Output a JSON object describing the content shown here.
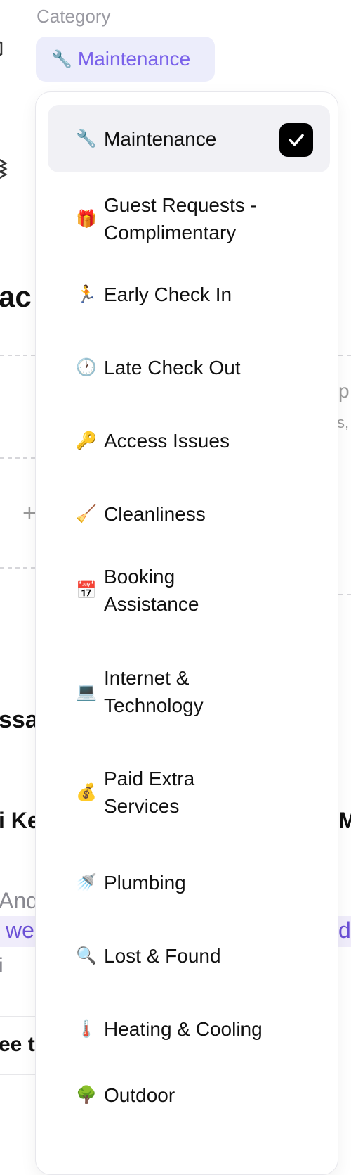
{
  "category": {
    "label": "Category",
    "selected": {
      "icon": "🔧",
      "label": "Maintenance"
    }
  },
  "dropdown": {
    "options": [
      {
        "icon": "🔧",
        "label": "Maintenance",
        "selected": true
      },
      {
        "icon": "🎁",
        "label": "Guest Requests - Complimentary",
        "selected": false
      },
      {
        "icon": "🏃",
        "label": "Early Check In",
        "selected": false
      },
      {
        "icon": "🕐",
        "label": "Late Check Out",
        "selected": false
      },
      {
        "icon": "🔑",
        "label": "Access Issues",
        "selected": false
      },
      {
        "icon": "🧹",
        "label": "Cleanliness",
        "selected": false
      },
      {
        "icon": "📅",
        "label": "Booking Assistance",
        "selected": false
      },
      {
        "icon": "💻",
        "label": "Internet & Technology",
        "selected": false
      },
      {
        "icon": "💰",
        "label": "Paid Extra Services",
        "selected": false
      },
      {
        "icon": "🚿",
        "label": "Plumbing",
        "selected": false
      },
      {
        "icon": "🔍",
        "label": "Lost & Found",
        "selected": false
      },
      {
        "icon": "🌡️",
        "label": "Heating & Cooling",
        "selected": false
      },
      {
        "icon": "🌳",
        "label": "Outdoor",
        "selected": false
      }
    ]
  },
  "background": {
    "left_fragments": [
      "ac",
      "ssa",
      "i Ke",
      "And",
      "we",
      "i",
      "ee t"
    ],
    "right_fragments": [
      "p",
      "s,",
      "M",
      "da"
    ],
    "plus_icon": "+"
  }
}
